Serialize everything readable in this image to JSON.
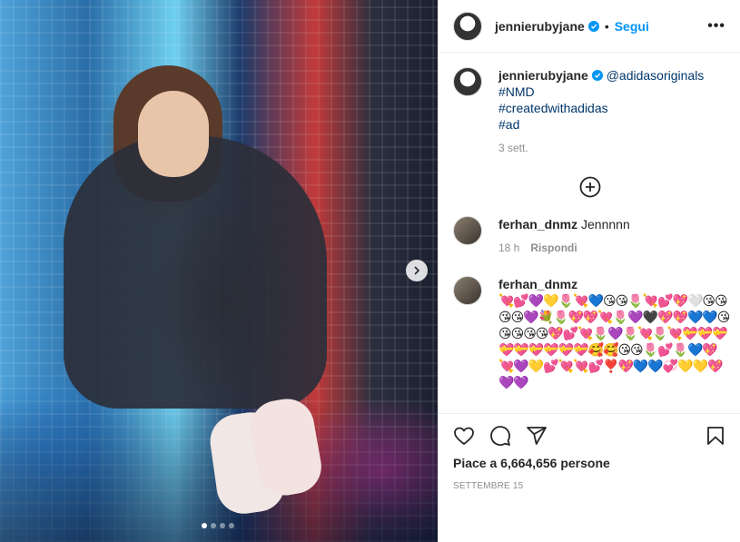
{
  "post": {
    "username": "jennierubyjane",
    "follow_label": "Segui",
    "more_label": "•••",
    "separator": "•",
    "slide_count": 4,
    "active_slide": 1
  },
  "caption": {
    "username": "jennierubyjane",
    "mention": "@adidasoriginals",
    "tags": [
      "#NMD",
      "#createdwithadidas",
      "#ad"
    ],
    "time": "3 sett."
  },
  "comments": [
    {
      "username": "ferhan_dnmz",
      "text": "Jennnnn",
      "time": "18 h",
      "reply_label": "Rispondi"
    },
    {
      "username": "ferhan_dnmz",
      "text": "💘💕💜💛🌷💘💙😘😘🌷💘💕💖🤍😘😘😘😘💜💐🌷💖💖💘🌷💜🖤💖💖💙💙😘😘😘😘😘💖💕💘🌷💜🌷💘🌷💘💝💝💝💝💝💝💝💝💝🥰🥰😘😘🌷💕🌷💙💖💘💜💛💕💘💘💕❣️💖💙💙💞💛💛💖💜💜"
    }
  ],
  "actions": {
    "likes_text": "Piace a 6,664,656 persone",
    "date": "SETTEMBRE 15"
  },
  "colors": {
    "link": "#00376b",
    "follow": "#0095f6",
    "verified": "#0095f6",
    "muted": "#8e8e8e"
  },
  "icons": [
    "chevron-right-icon",
    "verified-badge-icon",
    "more-icon",
    "add-circle-icon",
    "heart-icon",
    "comment-icon",
    "share-icon",
    "bookmark-icon"
  ]
}
